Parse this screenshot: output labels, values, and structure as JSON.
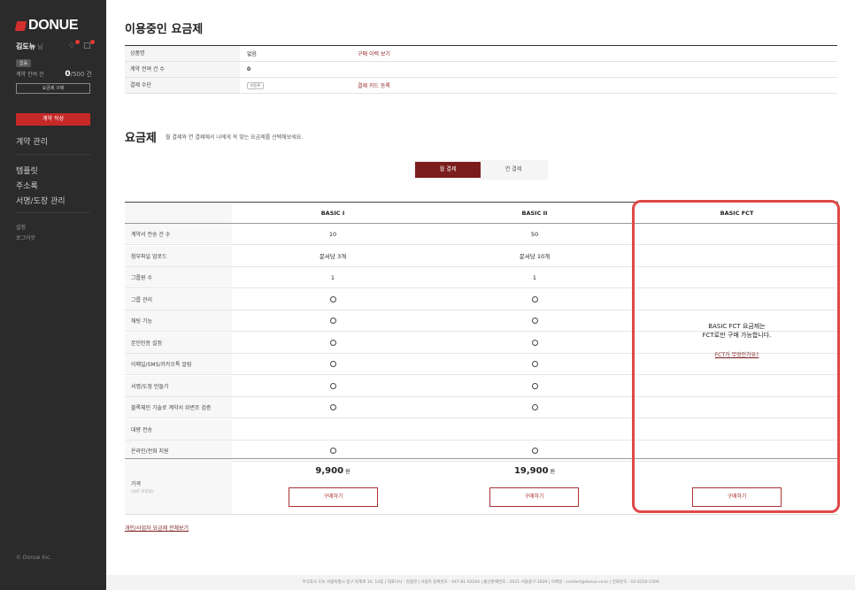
{
  "sidebar": {
    "logo": "DONUE",
    "user_name": "김도뉴",
    "user_suffix": "님",
    "plan_badge": "없음",
    "contract_left_label": "계약 잔여 건",
    "contract_left_count": "0",
    "contract_left_total": "/500 건",
    "buy_plan_button": "요금제 구매",
    "write_contract_button": "계약 작성",
    "menu": [
      "계약 관리",
      "템플릿",
      "주소록",
      "서명/도장 관리"
    ],
    "small_menu": [
      "설정",
      "로그아웃"
    ],
    "copyright": "© Donue Inc.",
    "notification_dot_color": "#e53935"
  },
  "main": {
    "title": "이용중인 요금제",
    "info": {
      "product_label": "상품명",
      "product_value": "없음",
      "product_link": "구매 이력 보기",
      "remaining_label": "계약 전여 건 수",
      "remaining_value": "0",
      "payment_label": "결제 수단",
      "payment_badge": "미등록",
      "payment_link": "결제 카드 등록"
    },
    "plans_title": "요금제",
    "plans_subtitle": "월 결제와 연 결제에서 나에게 꼭 맞는 요금제를 선택해보세요.",
    "toggle": {
      "monthly": "월 결제",
      "yearly": "연 결제"
    },
    "table": {
      "headers": [
        "BASIC I",
        "BASIC II",
        "BASIC FCT"
      ],
      "rows": [
        {
          "label": "계약서 전송 건 수",
          "c1": "10",
          "c2": "50"
        },
        {
          "label": "첨부파일 업로드",
          "c1": "문서당 3개",
          "c2": "문서당 10개"
        },
        {
          "label": "그룹원 수",
          "c1": "1",
          "c2": "1"
        },
        {
          "label": "그룹 관리",
          "c1": "O",
          "c2": "O"
        },
        {
          "label": "채팅 기능",
          "c1": "O",
          "c2": "O"
        },
        {
          "label": "본인인증 설정",
          "c1": "O",
          "c2": "O"
        },
        {
          "label": "이메일/SMS/카카오톡 알림",
          "c1": "O",
          "c2": "O"
        },
        {
          "label": "서명/도장 만들기",
          "c1": "O",
          "c2": "O"
        },
        {
          "label": "블록체인 기술로 계약서 위변조 검증",
          "c1": "O",
          "c2": "O"
        },
        {
          "label": "대량 전송",
          "c1": "",
          "c2": ""
        },
        {
          "label": "온라인/전화 지원",
          "c1": "O",
          "c2": "O"
        }
      ],
      "price_label": "가격",
      "price_vat": "(VAT 미포함)",
      "price_1": "9,900",
      "price_2": "19,900",
      "price_unit": "원",
      "buy_label": "구매하기",
      "fct_msg_line1": "BASIC FCT 요금제는",
      "fct_msg_line2": "FCT로만 구매 가능합니다.",
      "fct_link": "FCT가 무엇인가요?"
    },
    "all_plans_link": "개인/사업자 요금제 전체보기",
    "footer": "주식회사 도뉴   서울특별시 중구 퇴계로 10, 14층   |   대표이사 : 김형관   |   사업자 등록번호 : 447-81-02244   |   통신판매번호 : 2021-서울중구-1839   |   이메일 : contact@donue.co.kr   |   전화번호 : 02-6250-5300",
    "accent_color": "#7b1c1c",
    "highlight_color": "#e04848"
  }
}
